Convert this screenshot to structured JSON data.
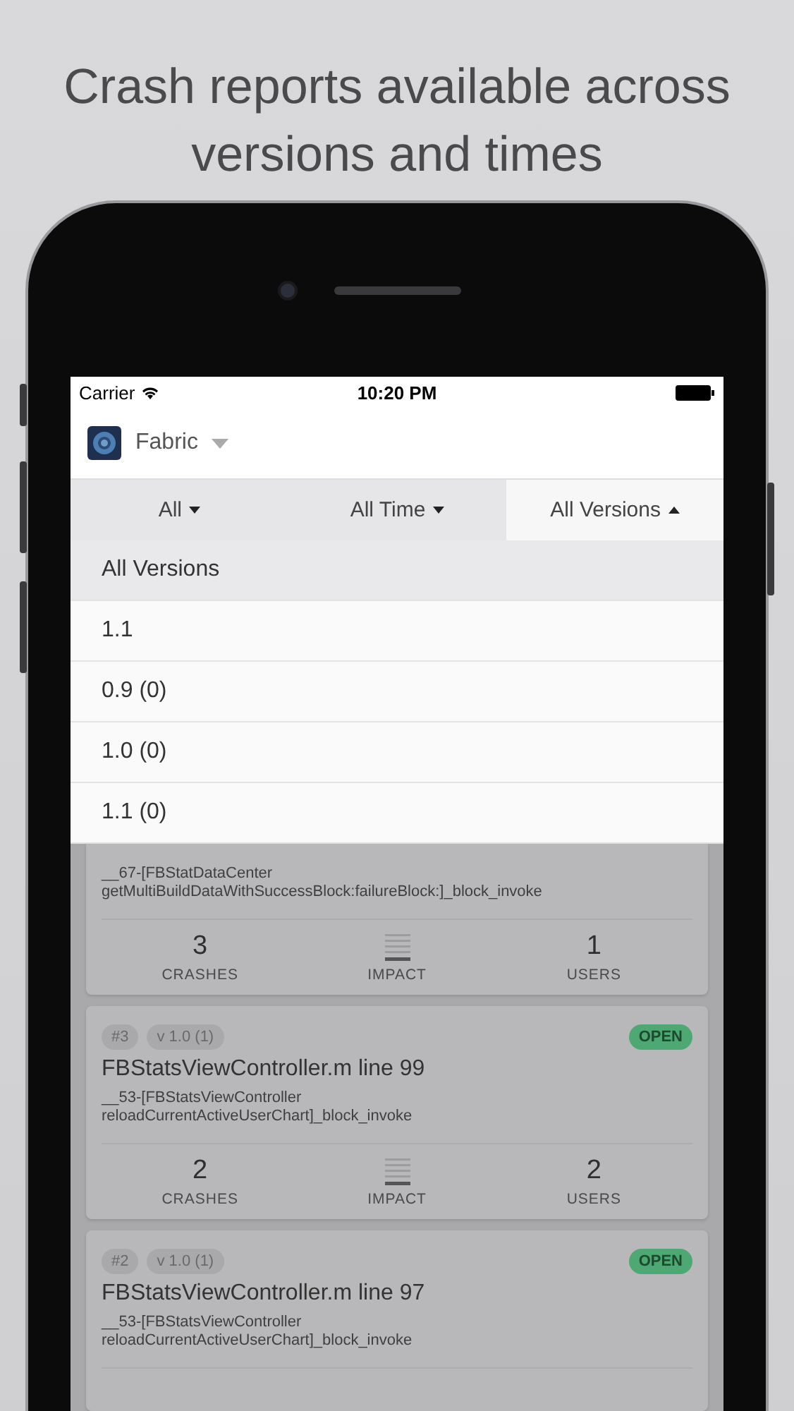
{
  "headline": "Crash reports available across versions and times",
  "status_bar": {
    "carrier": "Carrier",
    "time": "10:20 PM"
  },
  "app": {
    "name": "Fabric"
  },
  "filters": [
    {
      "label": "All",
      "selected": false,
      "expanded": false
    },
    {
      "label": "All Time",
      "selected": false,
      "expanded": false
    },
    {
      "label": "All Versions",
      "selected": true,
      "expanded": true
    }
  ],
  "dropdown": [
    {
      "label": "All Versions",
      "selected": true
    },
    {
      "label": "1.1",
      "selected": false
    },
    {
      "label": "0.9 (0)",
      "selected": false
    },
    {
      "label": "1.0 (0)",
      "selected": false
    },
    {
      "label": "1.1 (0)",
      "selected": false
    }
  ],
  "issues": [
    {
      "method": [
        "__67-[FBStatDataCenter",
        "getMultiBuildDataWithSuccessBlock:failureBlock:]_block_invoke"
      ],
      "stats": [
        {
          "kind": "count",
          "value": "3",
          "label": "CRASHES"
        },
        {
          "kind": "impact",
          "label": "IMPACT"
        },
        {
          "kind": "count",
          "value": "1",
          "label": "USERS"
        }
      ]
    },
    {
      "number": "#3",
      "version": "v 1.0 (1)",
      "status": "OPEN",
      "title": "FBStatsViewController.m line 99",
      "method": [
        "__53-[FBStatsViewController",
        "reloadCurrentActiveUserChart]_block_invoke"
      ],
      "stats": [
        {
          "kind": "count",
          "value": "2",
          "label": "CRASHES"
        },
        {
          "kind": "impact",
          "label": "IMPACT"
        },
        {
          "kind": "count",
          "value": "2",
          "label": "USERS"
        }
      ]
    },
    {
      "number": "#2",
      "version": "v 1.0 (1)",
      "status": "OPEN",
      "title": "FBStatsViewController.m line 97",
      "method": [
        "__53-[FBStatsViewController",
        "reloadCurrentActiveUserChart]_block_invoke"
      ]
    }
  ]
}
